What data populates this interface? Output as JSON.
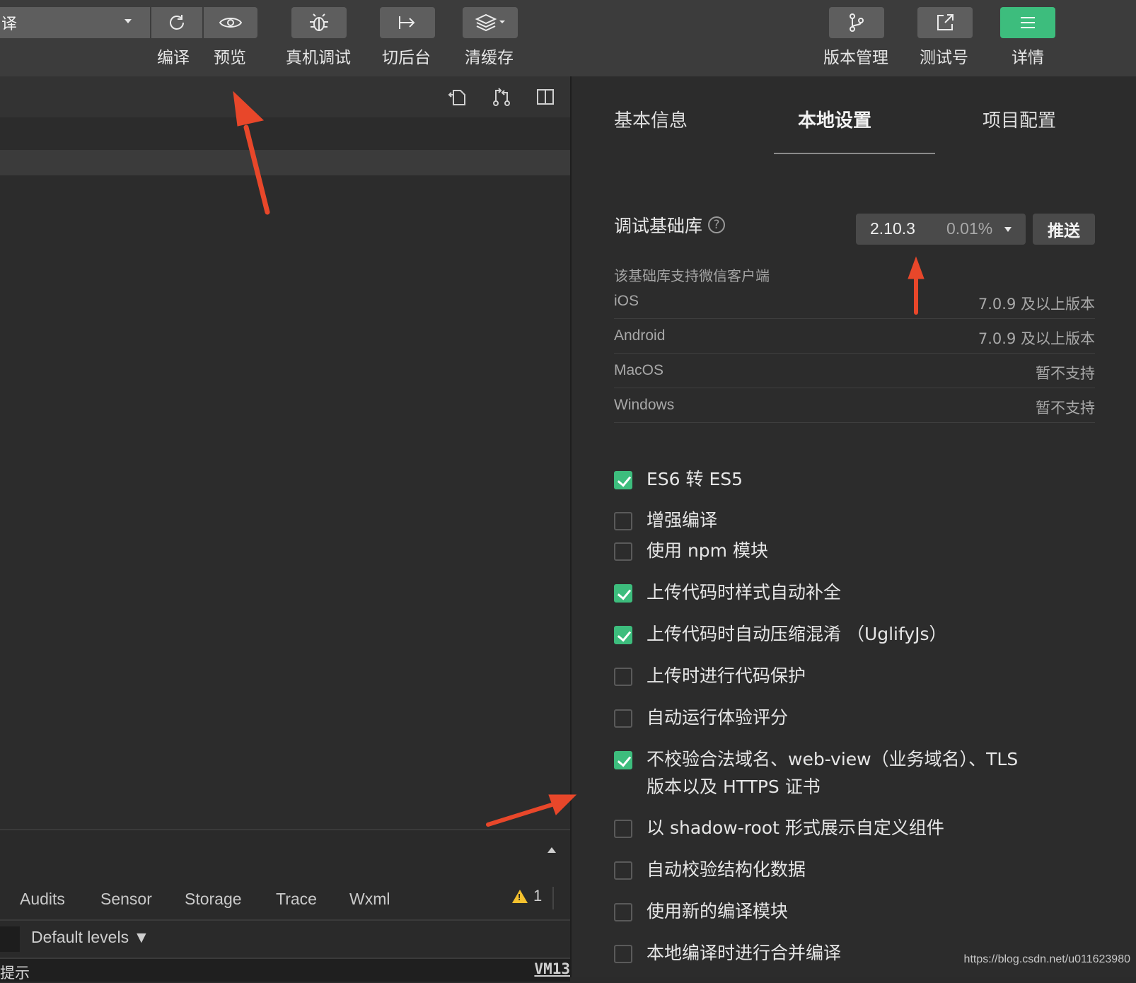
{
  "toolbar": {
    "mode_select_value": "译",
    "buttons": [
      {
        "label": "编译",
        "icon": "refresh-icon"
      },
      {
        "label": "预览",
        "icon": "eye-icon"
      },
      {
        "label": "真机调试",
        "icon": "bug-icon"
      },
      {
        "label": "切后台",
        "icon": "switch-background-icon"
      },
      {
        "label": "清缓存",
        "icon": "layers-icon"
      },
      {
        "label": "版本管理",
        "icon": "branch-icon"
      },
      {
        "label": "测试号",
        "icon": "external-link-icon"
      },
      {
        "label": "详情",
        "icon": "menu-icon"
      }
    ]
  },
  "editor": {
    "tools": [
      "file-compare-icon",
      "git-compare-icon",
      "split-view-icon"
    ]
  },
  "devtools": {
    "tabs": [
      "Audits",
      "Sensor",
      "Storage",
      "Trace",
      "Wxml"
    ],
    "warning_count": "1",
    "levels": "Default levels ▼",
    "hint": "提示",
    "vm": "VM13"
  },
  "details": {
    "tabs": [
      "基本信息",
      "本地设置",
      "项目配置"
    ],
    "active_tab": "本地设置",
    "lib_label": "调试基础库",
    "lib_version": "2.10.3",
    "lib_percent": "0.01%",
    "push_label": "推送",
    "support_title": "该基础库支持微信客户端",
    "support": [
      {
        "os": "iOS",
        "version": "7.0.9 及以上版本"
      },
      {
        "os": "Android",
        "version": "7.0.9 及以上版本"
      },
      {
        "os": "MacOS",
        "version": "暂不支持"
      },
      {
        "os": "Windows",
        "version": "暂不支持"
      }
    ],
    "options": [
      {
        "label": "ES6 转 ES5",
        "checked": true
      },
      {
        "label": "增强编译",
        "checked": false
      },
      {
        "label": "使用 npm 模块",
        "checked": false
      },
      {
        "label": "上传代码时样式自动补全",
        "checked": true
      },
      {
        "label": "上传代码时自动压缩混淆 （UglifyJs）",
        "checked": true
      },
      {
        "label": "上传时进行代码保护",
        "checked": false
      },
      {
        "label": "自动运行体验评分",
        "checked": false
      },
      {
        "label": "不校验合法域名、web-view（业务域名）、TLS",
        "label2": "版本以及 HTTPS 证书",
        "checked": true
      },
      {
        "label": "以 shadow-root 形式展示自定义组件",
        "checked": false
      },
      {
        "label": "自动校验结构化数据",
        "checked": false
      },
      {
        "label": "使用新的编译模块",
        "checked": false
      },
      {
        "label": "本地编译时进行合并编译",
        "checked": false
      }
    ]
  },
  "watermark": "https://blog.csdn.net/u011623980",
  "colors": {
    "accent_green": "#3dbd7d",
    "annotation_arrow": "#e8472a"
  }
}
